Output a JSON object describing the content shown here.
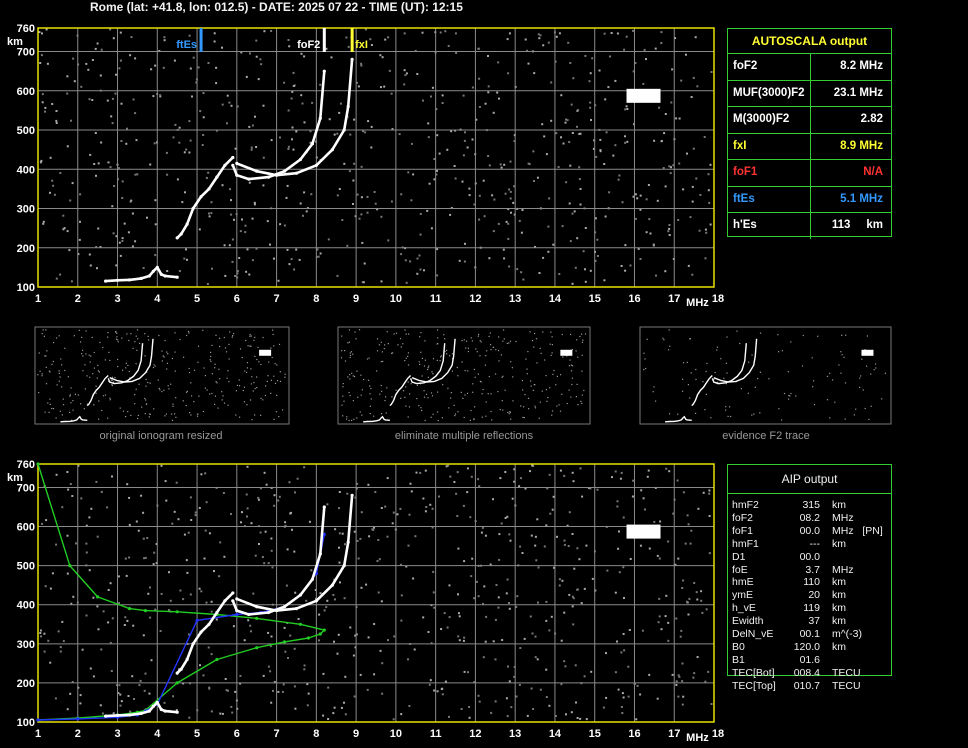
{
  "header": "Rome (lat: +41.8, lon: 012.5) - DATE: 2025 07 22 - TIME (UT): 12:15",
  "colors": {
    "grid": "#8a8a8a",
    "axis": "#e8e000",
    "panel_border": "#33cc33",
    "ftEs": "#3399ff",
    "fxI": "#ffff33",
    "foF1": "#ff3333",
    "trace": "#ffffff",
    "aip_profile": "#2233ff",
    "model_profile": "#22cc22"
  },
  "chart_data": [
    {
      "type": "scatter",
      "name": "ionogram-autoscala",
      "x_unit": "MHz",
      "y_unit": "km",
      "xlim": [
        1,
        18
      ],
      "ylim": [
        100,
        760
      ],
      "x_ticks": [
        1,
        2,
        3,
        4,
        5,
        6,
        7,
        8,
        9,
        10,
        11,
        12,
        13,
        14,
        15,
        16,
        17,
        18
      ],
      "y_ticks": [
        100,
        200,
        300,
        400,
        500,
        600,
        700,
        760
      ],
      "grid": true,
      "markers": [
        {
          "label": "ftEs",
          "x": 5.1,
          "color": "#3399ff"
        },
        {
          "label": "foF2",
          "x": 8.2,
          "color": "#ffffff"
        },
        {
          "label": "fxI",
          "x": 8.9,
          "color": "#ffff33"
        }
      ],
      "series": [
        {
          "x": [
            2.7,
            3.0,
            3.3,
            3.6,
            3.8,
            3.9,
            4.0,
            4.1,
            4.2,
            4.5
          ],
          "y": [
            115,
            117,
            118,
            122,
            128,
            140,
            150,
            132,
            128,
            125
          ]
        },
        {
          "x": [
            4.5,
            4.6,
            4.75,
            4.9,
            5.1,
            5.3,
            5.5,
            5.7,
            5.9
          ],
          "y": [
            225,
            235,
            260,
            300,
            330,
            350,
            380,
            410,
            430
          ]
        },
        {
          "x": [
            5.9,
            6.0,
            6.3,
            6.8,
            7.2,
            7.6,
            7.9,
            8.1,
            8.2
          ],
          "y": [
            410,
            385,
            375,
            380,
            395,
            425,
            465,
            530,
            650
          ]
        },
        {
          "x": [
            6.0,
            6.5,
            7.0,
            7.5,
            8.0,
            8.4,
            8.7,
            8.8,
            8.9
          ],
          "y": [
            415,
            395,
            385,
            390,
            410,
            450,
            500,
            560,
            680
          ]
        }
      ]
    },
    {
      "type": "line",
      "name": "ionogram-aip",
      "x_unit": "MHz",
      "y_unit": "km",
      "xlim": [
        1,
        18
      ],
      "ylim": [
        100,
        760
      ],
      "x_ticks": [
        1,
        2,
        3,
        4,
        5,
        6,
        7,
        8,
        9,
        10,
        11,
        12,
        13,
        14,
        15,
        16,
        17,
        18
      ],
      "y_ticks": [
        100,
        200,
        300,
        400,
        500,
        600,
        700,
        760
      ],
      "grid": true,
      "series": [
        {
          "x": [
            1.0,
            2.0,
            3.0,
            3.5,
            3.7,
            4.5,
            5.5,
            6.5,
            7.2,
            7.8,
            8.1,
            8.2,
            7.6,
            6.5,
            5.5,
            4.5,
            3.7,
            3.3,
            2.5,
            1.8,
            1.0
          ],
          "y": [
            105,
            110,
            118,
            125,
            130,
            200,
            260,
            290,
            305,
            315,
            325,
            335,
            350,
            365,
            375,
            382,
            385,
            390,
            420,
            500,
            760
          ],
          "color": "#22cc22"
        },
        {
          "x": [
            1.0,
            2.0,
            3.0,
            3.5,
            3.7,
            4.0,
            5.0,
            6.0,
            6.6,
            7.2,
            7.6,
            8.0,
            8.2
          ],
          "y": [
            105,
            108,
            112,
            118,
            128,
            145,
            360,
            375,
            380,
            395,
            425,
            480,
            580
          ],
          "color": "#2233ff"
        },
        {
          "x": [
            2.7,
            3.0,
            3.3,
            3.6,
            3.8,
            3.9,
            4.0,
            4.1,
            4.2,
            4.5
          ],
          "y": [
            115,
            117,
            118,
            122,
            128,
            140,
            150,
            132,
            128,
            125
          ],
          "color": "#ffffff"
        },
        {
          "x": [
            4.5,
            4.6,
            4.75,
            4.9,
            5.1,
            5.3,
            5.5,
            5.7,
            5.9
          ],
          "y": [
            225,
            235,
            260,
            300,
            330,
            350,
            380,
            410,
            430
          ],
          "color": "#ffffff"
        },
        {
          "x": [
            5.9,
            6.0,
            6.3,
            6.8,
            7.2,
            7.6,
            7.9,
            8.1,
            8.2
          ],
          "y": [
            410,
            385,
            375,
            380,
            395,
            425,
            465,
            530,
            650
          ],
          "color": "#ffffff"
        },
        {
          "x": [
            6.0,
            6.5,
            7.0,
            7.5,
            8.0,
            8.4,
            8.7,
            8.8,
            8.9
          ],
          "y": [
            415,
            395,
            385,
            390,
            410,
            450,
            500,
            560,
            680
          ],
          "color": "#ffffff"
        }
      ]
    }
  ],
  "axis": {
    "km_label": "km",
    "mhz_label": "MHz"
  },
  "thumbnails": [
    {
      "caption": "original ionogram resized"
    },
    {
      "caption": "eliminate multiple reflections"
    },
    {
      "caption": "evidence F2 trace"
    }
  ],
  "autoscala": {
    "title": "AUTOSCALA output",
    "rows": [
      {
        "label": "foF2",
        "value": "8.2 MHz",
        "color": "#ffffff"
      },
      {
        "label": "MUF(3000)F2",
        "value": "23.1 MHz",
        "color": "#ffffff"
      },
      {
        "label": "M(3000)F2",
        "value": "2.82",
        "color": "#ffffff"
      },
      {
        "label": "fxI",
        "value": "8.9 MHz",
        "color": "#ffff33"
      },
      {
        "label": "foF1",
        "value": "N/A",
        "color": "#ff3333"
      },
      {
        "label": "ftEs",
        "value": "5.1 MHz",
        "color": "#3399ff"
      },
      {
        "label": "h'Es",
        "value": "113     km",
        "color": "#ffffff"
      }
    ]
  },
  "aip": {
    "title": "AIP output",
    "rows": [
      {
        "name": "hmF2",
        "value": "315",
        "unit": "km"
      },
      {
        "name": "foF2",
        "value": "08.2",
        "unit": "MHz"
      },
      {
        "name": "foF1",
        "value": "00.0",
        "unit": "MHz   [PN]"
      },
      {
        "name": "hmF1",
        "value": "---",
        "unit": "km"
      },
      {
        "name": "D1",
        "value": "00.0",
        "unit": ""
      },
      {
        "name": "foE",
        "value": "3.7",
        "unit": "MHz"
      },
      {
        "name": "hmE",
        "value": "110",
        "unit": "km"
      },
      {
        "name": "ymE",
        "value": "20",
        "unit": "km"
      },
      {
        "name": "h_vE",
        "value": "119",
        "unit": "km"
      },
      {
        "name": "Ewidth",
        "value": "37",
        "unit": "km"
      },
      {
        "name": "DelN_vE",
        "value": "00.1",
        "unit": "m^(-3)"
      },
      {
        "name": "B0",
        "value": "120.0",
        "unit": "km"
      },
      {
        "name": "B1",
        "value": "01.6",
        "unit": ""
      },
      {
        "name": "TEC[Bot]",
        "value": "008.4",
        "unit": "TECU"
      },
      {
        "name": "TEC[Top]",
        "value": "010.7",
        "unit": "TECU"
      }
    ]
  }
}
